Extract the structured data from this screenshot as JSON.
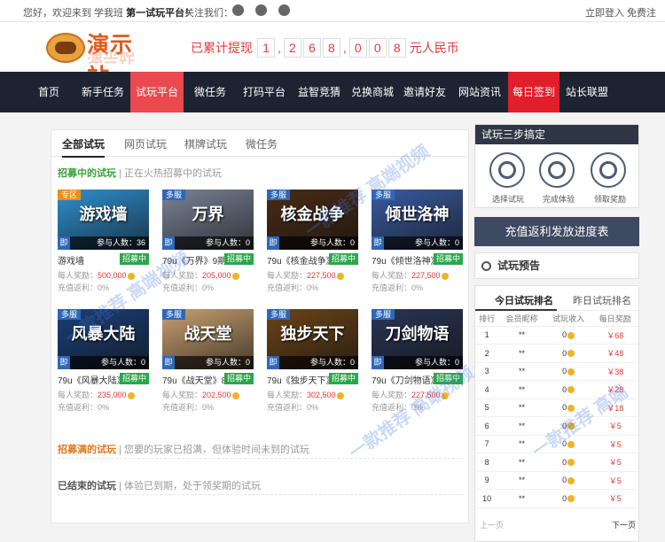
{
  "topbar": {
    "welcome": "您好，欢迎来到 学我班",
    "welcome_strong": "第一试玩平台！",
    "follow": "关注我们：",
    "login": "立即登入",
    "register": "免费注册"
  },
  "logo": {
    "text": "演示站"
  },
  "total": {
    "prefix": "已累计提现",
    "digits": [
      "1",
      "2",
      "6",
      "8",
      "0",
      "0",
      "8"
    ],
    "suffix": "元人民币"
  },
  "nav": [
    "首页",
    "新手任务",
    "试玩平台",
    "微任务",
    "打码平台",
    "益智竞猜",
    "兑换商城",
    "邀请好友",
    "网站资讯",
    "每日签到",
    "站长联盟"
  ],
  "tabs": [
    "全部试玩",
    "网页试玩",
    "棋牌试玩",
    "微任务"
  ],
  "recruiting": {
    "title": "招募中的试玩",
    "desc": "| 正在火热招募中的试玩"
  },
  "games": [
    {
      "tag": "专区",
      "tagColor": "#f08c1a",
      "img_text": "游戏墙",
      "name": "游戏墙",
      "players": "参与人数：36",
      "reward": "500,000",
      "rebate": "充值返利：0%",
      "badge": "招募中",
      "bg": "#2f8fd0"
    },
    {
      "tag": "多服",
      "tagColor": "#2f67b6",
      "img_text": "万界",
      "name": "79u《万界》9期",
      "players": "参与人数：0",
      "reward": "205,000",
      "rebate": "充值返利：0%",
      "badge": "招募中",
      "bg": "#7a8496"
    },
    {
      "tag": "多服",
      "tagColor": "#2f67b6",
      "img_text": "核金战争",
      "name": "79u《核金战争》5期",
      "players": "参与人数：0",
      "reward": "227,500",
      "rebate": "充值返利：0%",
      "badge": "招募中",
      "bg": "#4a2b16"
    },
    {
      "tag": "多服",
      "tagColor": "#2f67b6",
      "img_text": "倾世洛神",
      "name": "79u《倾世洛神》17期",
      "players": "参与人数：0",
      "reward": "227,500",
      "rebate": "充值返利：0%",
      "badge": "招募中",
      "bg": "#3a5aa0"
    },
    {
      "tag": "多服",
      "tagColor": "#2f67b6",
      "img_text": "风暴大陆",
      "name": "79u《风暴大陆》4期",
      "players": "参与人数：0",
      "reward": "235,000",
      "rebate": "充值返利：0%",
      "badge": "招募中",
      "bg": "#1a3f78"
    },
    {
      "tag": "多服",
      "tagColor": "#2f67b6",
      "img_text": "战天堂",
      "name": "79u《战天堂》8期",
      "players": "参与人数：0",
      "reward": "202,500",
      "rebate": "充值返利：0%",
      "badge": "招募中",
      "bg": "#c8a070"
    },
    {
      "tag": "多服",
      "tagColor": "#2f67b6",
      "img_text": "独步天下",
      "name": "79u《独步天下》24期",
      "players": "参与人数：0",
      "reward": "302,500",
      "rebate": "充值返利：0%",
      "badge": "招募中",
      "bg": "#6b4418"
    },
    {
      "tag": "多服",
      "tagColor": "#2f67b6",
      "img_text": "刀剑物语",
      "name": "79u《刀剑物语》1期",
      "players": "参与人数：0",
      "reward": "227,500",
      "rebate": "充值返利：0%",
      "badge": "招募中",
      "bg": "#2a3556"
    }
  ],
  "reward_label": "每人奖励：",
  "ji": "即",
  "full": {
    "title": "招募满的试玩",
    "desc": "| 您要的玩家已招满，但体验时间未到的试玩"
  },
  "ended": {
    "title": "已结束的试玩",
    "desc": "| 体验已到期，处于领奖期的试玩"
  },
  "steps": {
    "title": "试玩三步搞定",
    "labels": [
      "选择试玩",
      "完成体验",
      "领取奖励"
    ]
  },
  "progress_button": "充值返利发放进度表",
  "preview": "试玩预告",
  "rank": {
    "tabs": [
      "今日试玩排名",
      "昨日试玩排名"
    ],
    "headers": [
      "排行",
      "会员昵称",
      "试玩收入",
      "每日奖励"
    ],
    "rows": [
      {
        "r": "1",
        "nick": "**",
        "reward": "￥68"
      },
      {
        "r": "2",
        "nick": "**",
        "reward": "￥48"
      },
      {
        "r": "3",
        "nick": "**",
        "reward": "￥38"
      },
      {
        "r": "4",
        "nick": "**",
        "reward": "￥28"
      },
      {
        "r": "5",
        "nick": "**",
        "reward": "￥18"
      },
      {
        "r": "6",
        "nick": "**",
        "reward": "￥5"
      },
      {
        "r": "7",
        "nick": "**",
        "reward": "￥5"
      },
      {
        "r": "8",
        "nick": "**",
        "reward": "￥5"
      },
      {
        "r": "9",
        "nick": "**",
        "reward": "￥5"
      },
      {
        "r": "10",
        "nick": "**",
        "reward": "￥5"
      }
    ],
    "prev": "上一页",
    "next": "下一页"
  }
}
